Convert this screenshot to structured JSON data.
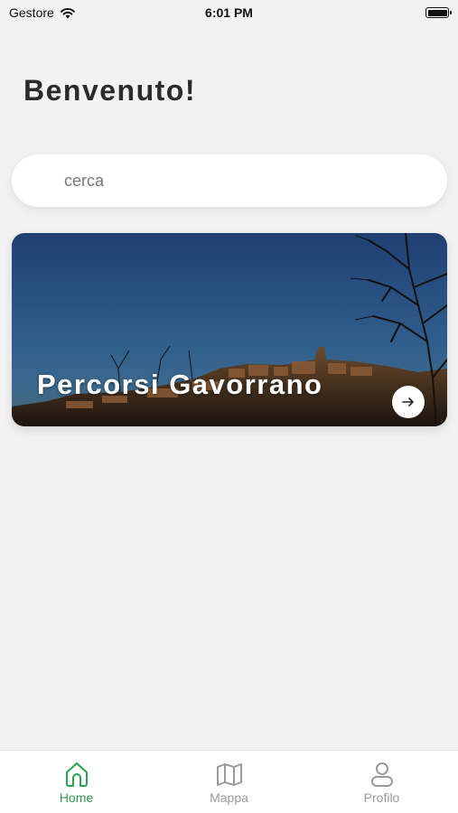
{
  "status_bar": {
    "carrier": "Gestore",
    "time": "6:01 PM",
    "wifi_icon": "wifi-icon",
    "battery_icon": "battery-icon"
  },
  "header": {
    "title": "Benvenuto!"
  },
  "search": {
    "placeholder": "cerca",
    "value": ""
  },
  "cards": [
    {
      "title": "Percorsi Gavorrano",
      "image": "town-at-dusk-photo",
      "action_icon": "arrow-right-icon"
    }
  ],
  "bottom_nav": {
    "active_color": "#2e9e4f",
    "inactive_color": "#9a9a9a",
    "items": [
      {
        "label": "Home",
        "icon": "home-icon",
        "active": true
      },
      {
        "label": "Mappa",
        "icon": "map-icon",
        "active": false
      },
      {
        "label": "Profilo",
        "icon": "profile-icon",
        "active": false
      }
    ]
  }
}
